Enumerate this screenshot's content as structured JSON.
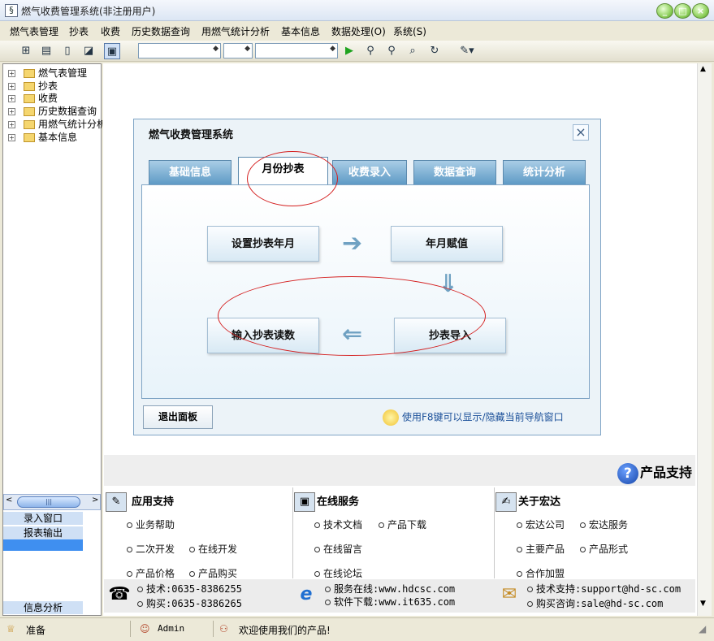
{
  "window": {
    "title": "燃气收费管理系统(非注册用户)",
    "controls": {
      "minimize": "_",
      "maximize": "□",
      "close": "×"
    }
  },
  "menubar": {
    "items": [
      "燃气表管理",
      "抄表",
      "收费",
      "历史数据查询",
      "用燃气统计分析",
      "基本信息",
      "数据处理(O)",
      "系统(S)"
    ]
  },
  "toolbar": {
    "icons": [
      "tree-icon",
      "list-icon",
      "document-icon",
      "chart-icon",
      "monitor-icon"
    ],
    "combo1": "",
    "combo2": "",
    "combo3": "",
    "action_icons": [
      "play-icon",
      "find-icon",
      "find-icon",
      "find-doc-icon",
      "refresh-icon",
      "pencil-icon"
    ]
  },
  "sidebar": {
    "tree": [
      {
        "label": "燃气表管理",
        "expander": "+",
        "open": true
      },
      {
        "label": "抄表",
        "expander": "+"
      },
      {
        "label": "收费",
        "expander": "+"
      },
      {
        "label": "历史数据查询",
        "expander": "+"
      },
      {
        "label": "用燃气统计分析",
        "expander": "+"
      },
      {
        "label": "基本信息",
        "expander": "+"
      }
    ],
    "scroll_thumb_glyph": "|||",
    "scroll_left": "<",
    "scroll_right": ">",
    "buttons": [
      "录入窗口",
      "报表输出"
    ],
    "bottom_button": "信息分析"
  },
  "nav_panel": {
    "title": "燃气收费管理系统",
    "close": "×",
    "tabs": [
      "基础信息",
      "月份抄表",
      "收费录入",
      "数据查询",
      "统计分析"
    ],
    "active_tab": 1,
    "flow": {
      "step1": "设置抄表年月",
      "step2": "年月赋值",
      "step3": "抄表导入",
      "step4": "输入抄表读数",
      "arrow_right": "➔",
      "arrow_down": "⇓",
      "arrow_left": "⇐"
    },
    "exit_button": "退出面板",
    "hint": "使用F8键可以显示/隐藏当前导航窗口"
  },
  "support": {
    "title": "产品支持",
    "q_glyph": "?",
    "columns": [
      {
        "title": "应用支持",
        "icon": "tools-icon",
        "glyph": "✎",
        "links": [
          [
            "业务帮助"
          ],
          [
            "二次开发",
            "在线开发"
          ],
          [
            "产品价格",
            "产品购买"
          ]
        ]
      },
      {
        "title": "在线服务",
        "icon": "computer-icon",
        "glyph": "▣",
        "links": [
          [
            "技术文档",
            "产品下载"
          ],
          [
            "在线留言"
          ],
          [
            "在线论坛"
          ]
        ]
      },
      {
        "title": "关于宏达",
        "icon": "pen-icon",
        "glyph": "✍",
        "links": [
          [
            "宏达公司",
            "宏达服务"
          ],
          [
            "主要产品",
            "产品形式"
          ],
          [
            "合作加盟"
          ]
        ]
      }
    ],
    "contacts": [
      {
        "icon": "telephone-icon",
        "glyph": "☎",
        "lines": [
          "技术:0635-8386255",
          "购买:0635-8386265"
        ]
      },
      {
        "icon": "internet-explorer-icon",
        "glyph": "e",
        "lines": [
          "服务在线:www.hdcsc.com",
          "软件下载:www.it635.com"
        ]
      },
      {
        "icon": "envelope-icon",
        "glyph": "✉",
        "lines": [
          "技术支持:support@hd-sc.com",
          "购买咨询:sale@hd-sc.com"
        ]
      }
    ]
  },
  "statusbar": {
    "status": "准备",
    "user": "Admin",
    "message": "欢迎使用我们的产品!"
  }
}
